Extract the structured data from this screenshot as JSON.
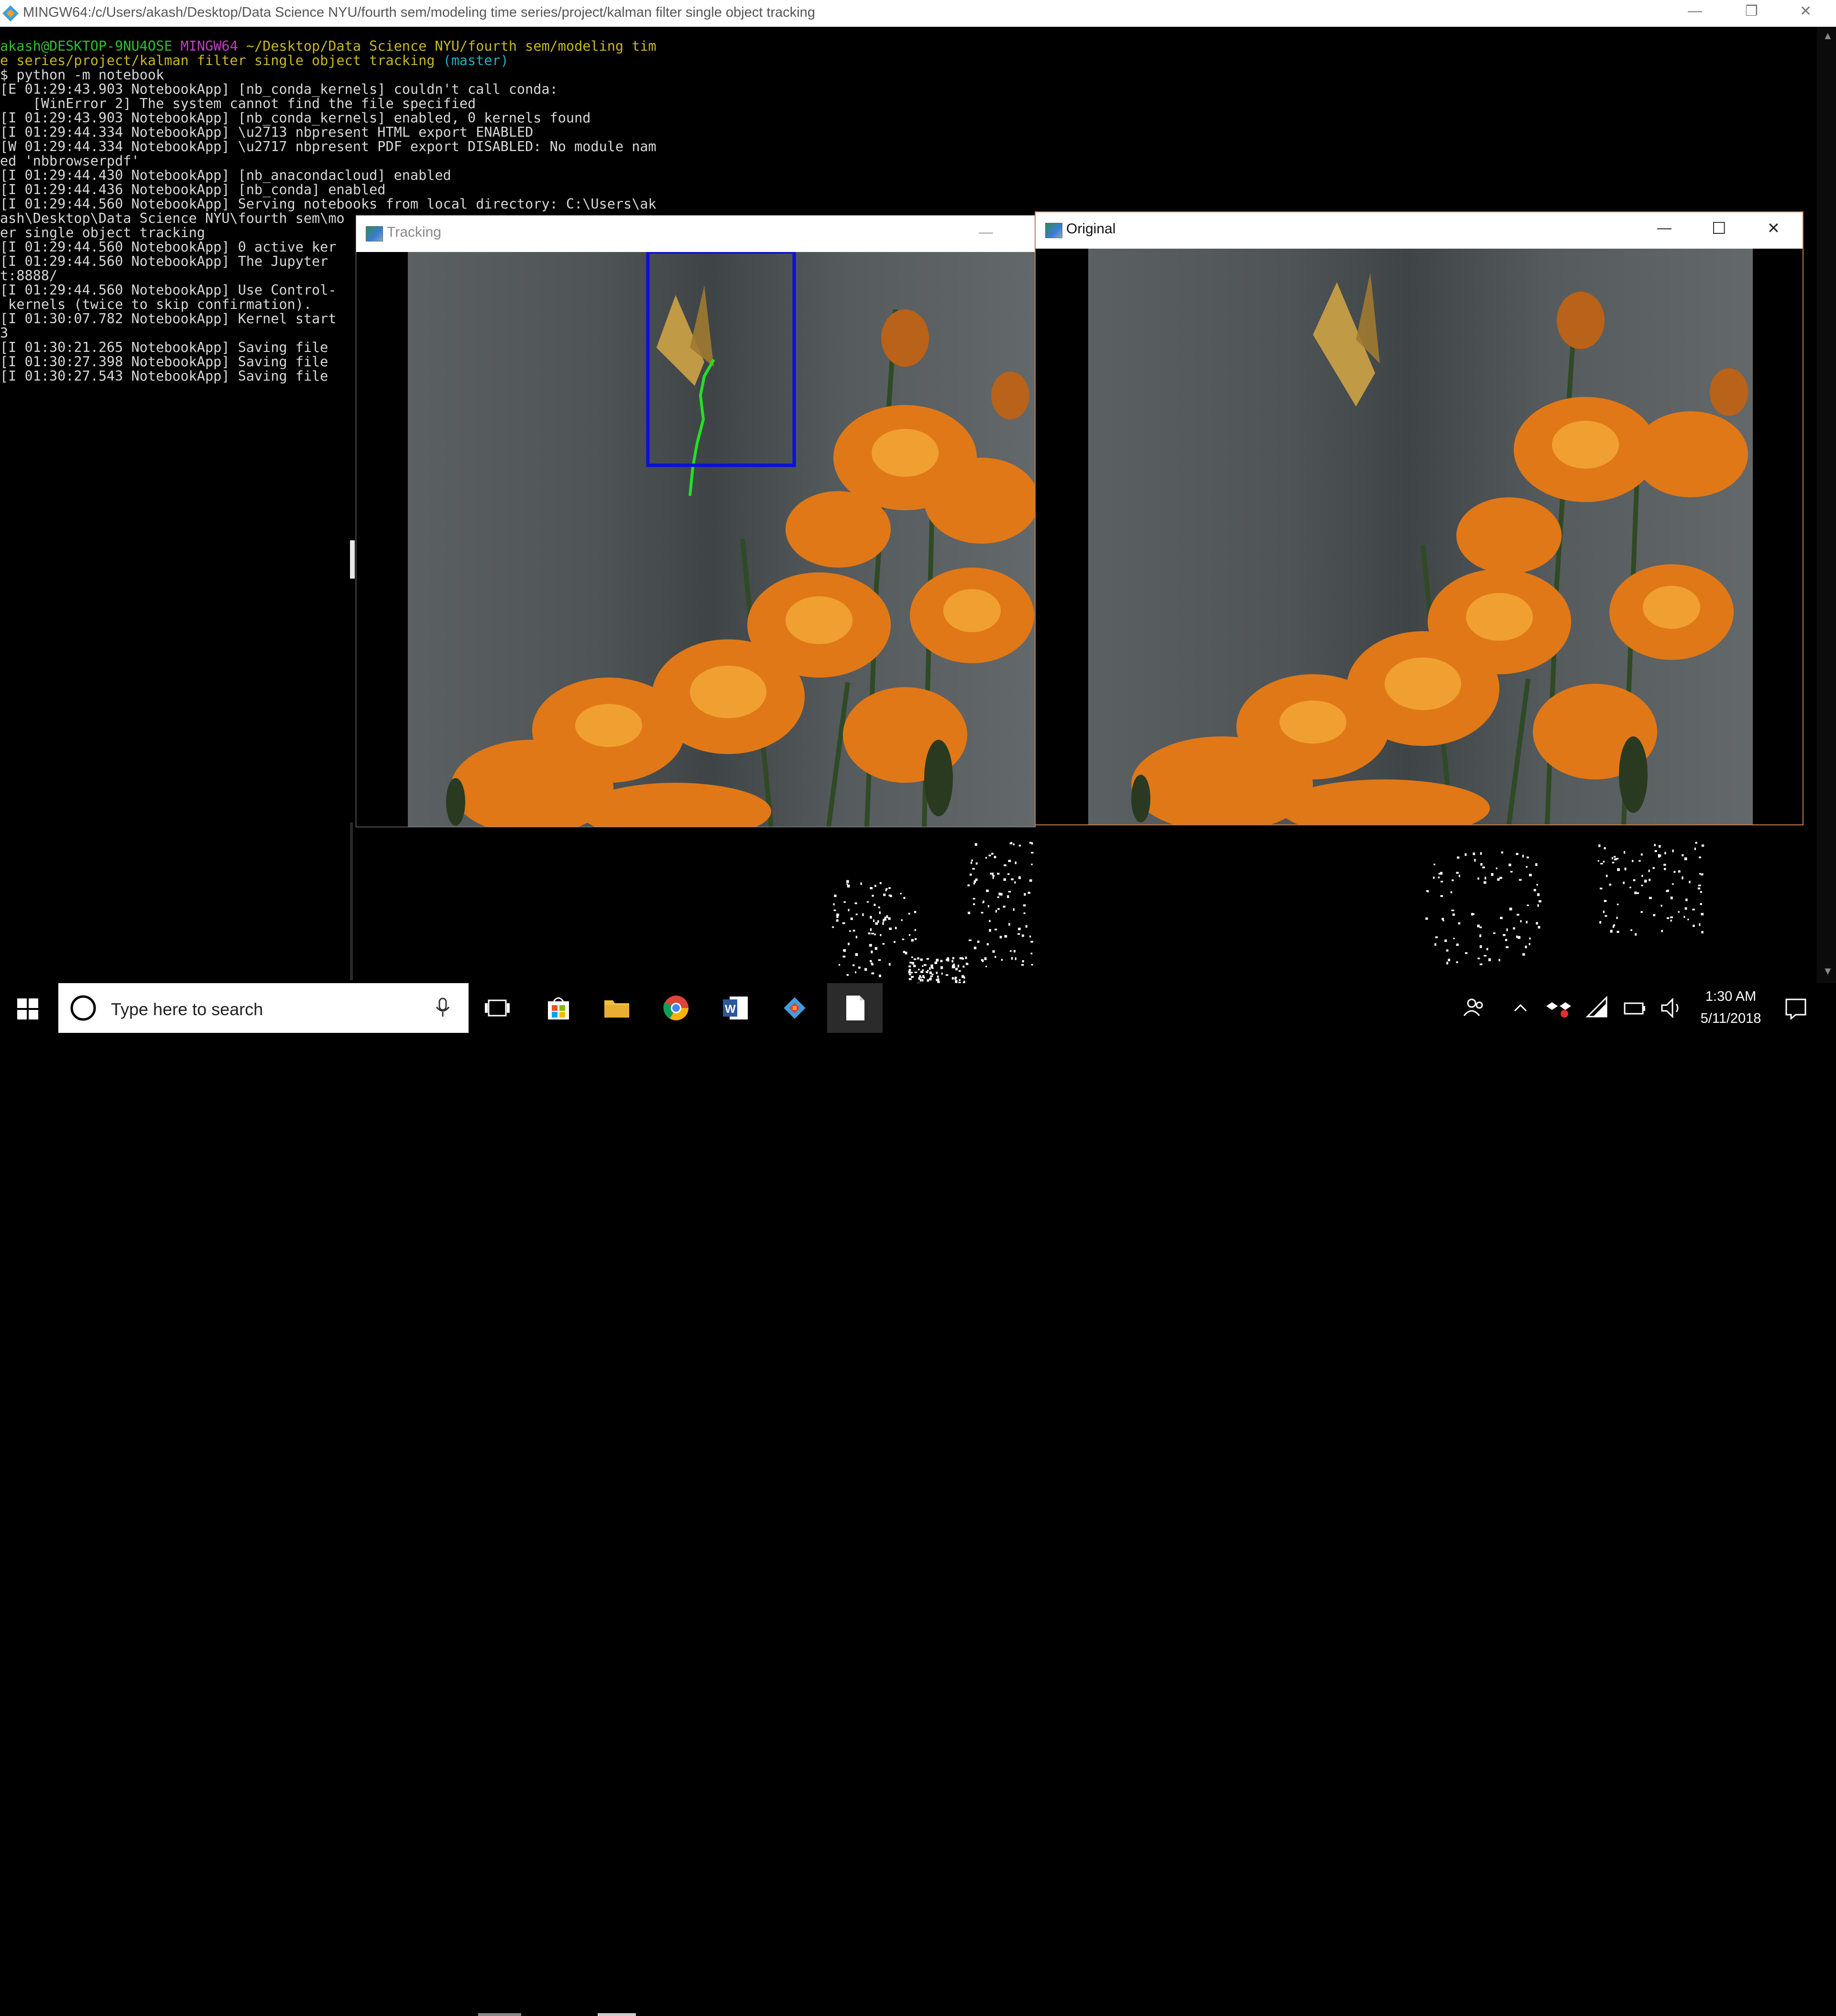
{
  "terminal": {
    "title": "MINGW64:/c/Users/akash/Desktop/Data Science NYU/fourth sem/modeling time series/project/kalman filter single object tracking",
    "prompt_user": "akash@DESKTOP-9NU4OSE",
    "prompt_shell": "MINGW64",
    "prompt_path_1": "~/Desktop/Data Science NYU/fourth sem/modeling tim",
    "prompt_path_2": "e series/project/kalman filter single object tracking",
    "prompt_branch": "(master)",
    "lines": [
      "$ python -m notebook",
      "[E 01:29:43.903 NotebookApp] [nb_conda_kernels] couldn't call conda:",
      "    [WinError 2] The system cannot find the file specified",
      "[I 01:29:43.903 NotebookApp] [nb_conda_kernels] enabled, 0 kernels found",
      "[I 01:29:44.334 NotebookApp] \\u2713 nbpresent HTML export ENABLED",
      "[W 01:29:44.334 NotebookApp] \\u2717 nbpresent PDF export DISABLED: No module nam",
      "ed 'nbbrowserpdf'",
      "[I 01:29:44.430 NotebookApp] [nb_anacondacloud] enabled",
      "[I 01:29:44.436 NotebookApp] [nb_conda] enabled",
      "[I 01:29:44.560 NotebookApp] Serving notebooks from local directory: C:\\Users\\ak",
      "ash\\Desktop\\Data Science NYU\\fourth sem\\mo",
      "er single object tracking",
      "[I 01:29:44.560 NotebookApp] 0 active ker",
      "[I 01:29:44.560 NotebookApp] The Jupyter",
      "t:8888/",
      "[I 01:29:44.560 NotebookApp] Use Control-",
      " kernels (twice to skip confirmation).",
      "[I 01:30:07.782 NotebookApp] Kernel start",
      "3",
      "[I 01:30:21.265 NotebookApp] Saving file",
      "[I 01:30:27.398 NotebookApp] Saving file",
      "[I 01:30:27.543 NotebookApp] Saving file"
    ]
  },
  "tracking_window": {
    "title": "Tracking",
    "minimize": "—"
  },
  "original_window": {
    "title": "Original",
    "minimize": "—",
    "maximize": "☐",
    "close": "✕"
  },
  "taskbar": {
    "search_placeholder": "Type here to search",
    "time": "1:30 AM",
    "date": "5/11/2018",
    "pinned": [
      "task-view",
      "store",
      "file-explorer",
      "chrome",
      "word",
      "git-gui",
      "notepad"
    ]
  }
}
